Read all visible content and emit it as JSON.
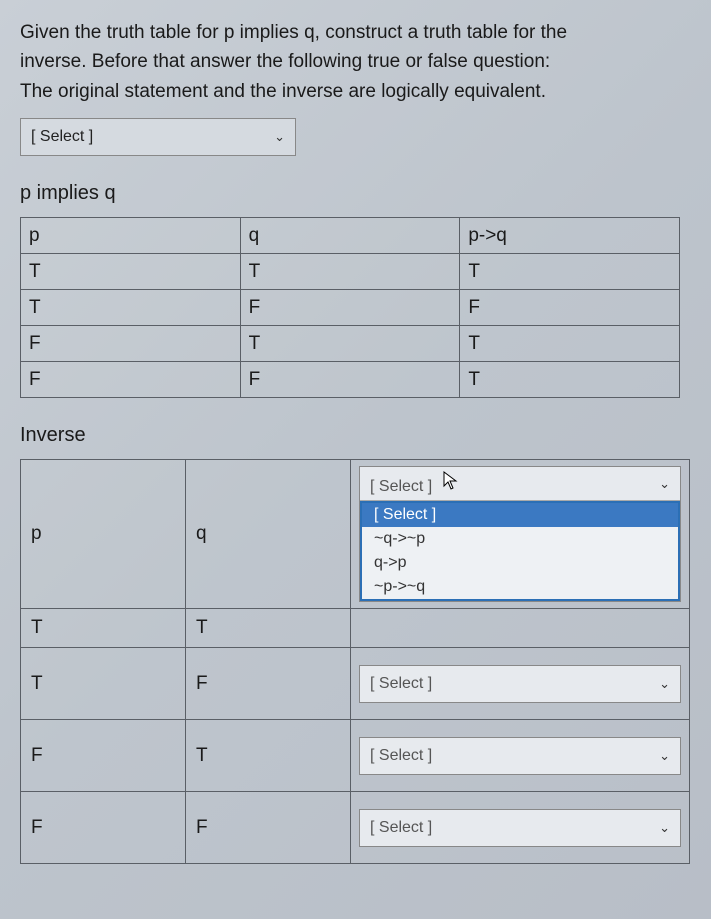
{
  "question": {
    "line1": "Given the truth table for p implies q, construct a truth table for the",
    "line2": "inverse.  Before that answer the following true or false question:",
    "line3": "The original statement and the inverse are logically equivalent."
  },
  "top_select": {
    "placeholder": "[ Select ]"
  },
  "section1": {
    "title": "p implies q",
    "headers": {
      "c1": "p",
      "c2": "q",
      "c3": "p->q"
    },
    "rows": [
      {
        "p": "T",
        "q": "T",
        "r": "T"
      },
      {
        "p": "T",
        "q": "F",
        "r": "F"
      },
      {
        "p": "F",
        "q": "T",
        "r": "T"
      },
      {
        "p": "F",
        "q": "F",
        "r": "T"
      }
    ]
  },
  "section2": {
    "title": "Inverse",
    "headers": {
      "c1": "p",
      "c2": "q"
    },
    "rows": [
      {
        "p": "T",
        "q": "T"
      },
      {
        "p": "T",
        "q": "F"
      },
      {
        "p": "F",
        "q": "T"
      },
      {
        "p": "F",
        "q": "F"
      }
    ],
    "select_placeholder": "[ Select ]",
    "dropdown": {
      "options": [
        "[ Select ]",
        "~q->~p",
        "q->p",
        "~p->~q"
      ],
      "selected_index": 0
    }
  }
}
